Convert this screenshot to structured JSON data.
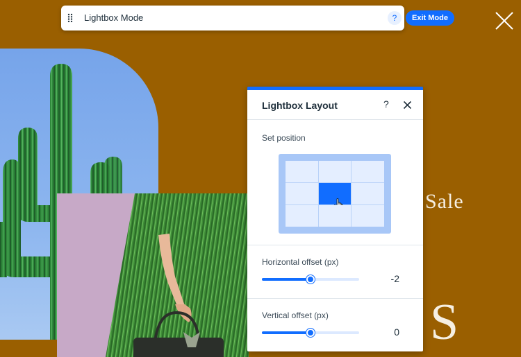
{
  "topbar": {
    "mode_label": "Lightbox Mode",
    "help_label": "?",
    "exit_label": "Exit Mode"
  },
  "background_text": {
    "sale": "Sale",
    "big_letter": "S"
  },
  "layout_panel": {
    "title": "Lightbox Layout",
    "help_label": "?",
    "position_label": "Set position",
    "position_grid": {
      "rows": 3,
      "cols": 3,
      "selected": "middle-center"
    },
    "horizontal": {
      "label": "Horizontal offset (px)",
      "value": "-2",
      "slider_fraction": 0.5
    },
    "vertical": {
      "label": "Vertical offset (px)",
      "value": "0",
      "slider_fraction": 0.5
    }
  },
  "icons": {
    "drag": "drag-handle-icon",
    "page_close": "close-icon",
    "panel_close": "close-icon",
    "pointer": "hand-pointer-icon"
  },
  "colors": {
    "page_background": "#9a5f00",
    "accent": "#116dff",
    "grid_frame": "#a8c7f7",
    "grid_cell": "#e4eeff",
    "sale_text": "#f6efe2"
  }
}
